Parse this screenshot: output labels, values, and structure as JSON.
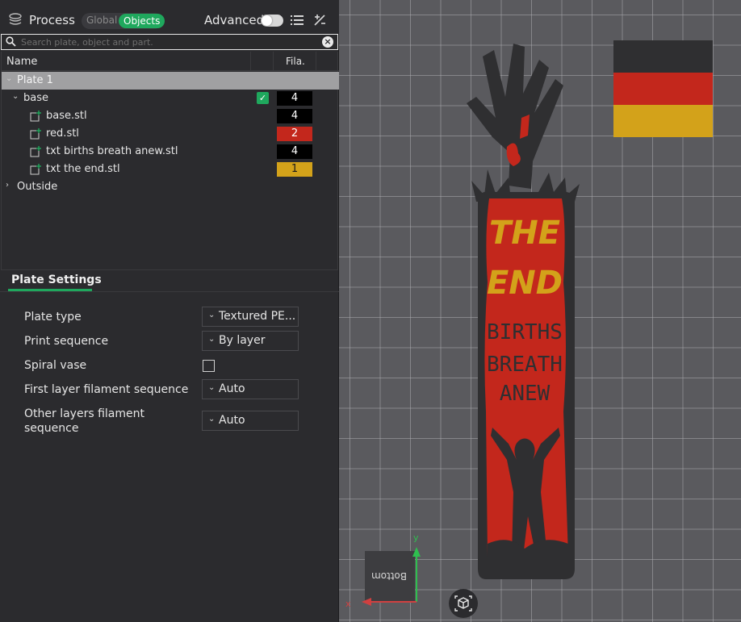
{
  "header": {
    "title": "Process",
    "mode_global": "Global",
    "mode_objects": "Objects",
    "advanced_label": "Advanced"
  },
  "search": {
    "placeholder": "Search plate, object and part."
  },
  "tree": {
    "col_name": "Name",
    "col_fila": "Fila.",
    "plate": "Plate 1",
    "object": {
      "name": "base",
      "filament": "4"
    },
    "parts": [
      {
        "name": "base.stl",
        "filament": "4",
        "color": "#000000"
      },
      {
        "name": "red.stl",
        "filament": "2",
        "color": "#c3271c"
      },
      {
        "name": "txt births breath anew.stl",
        "filament": "4",
        "color": "#000000"
      },
      {
        "name": "txt the end.stl",
        "filament": "1",
        "color": "#d3a21a"
      }
    ],
    "outside": "Outside"
  },
  "plate_settings": {
    "tab": "Plate Settings",
    "plate_type_label": "Plate type",
    "plate_type_value": "Textured PE...",
    "print_sequence_label": "Print sequence",
    "print_sequence_value": "By layer",
    "spiral_vase_label": "Spiral vase",
    "first_layer_label": "First layer filament sequence",
    "first_layer_value": "Auto",
    "other_layers_label_1": "Other layers filament",
    "other_layers_label_2": "sequence",
    "other_layers_value": "Auto"
  },
  "viewport": {
    "model_text": {
      "line1": "THE",
      "line2": "END",
      "line3": "BIRTHS",
      "line4": "BREATH",
      "line5": "ANEW"
    },
    "cube_label": "Bottom",
    "axis_x": "x",
    "axis_y": "y"
  },
  "colors": {
    "accent": "#1fa85d",
    "red": "#c3271c",
    "yellow": "#d3a21a",
    "black": "#000000"
  }
}
